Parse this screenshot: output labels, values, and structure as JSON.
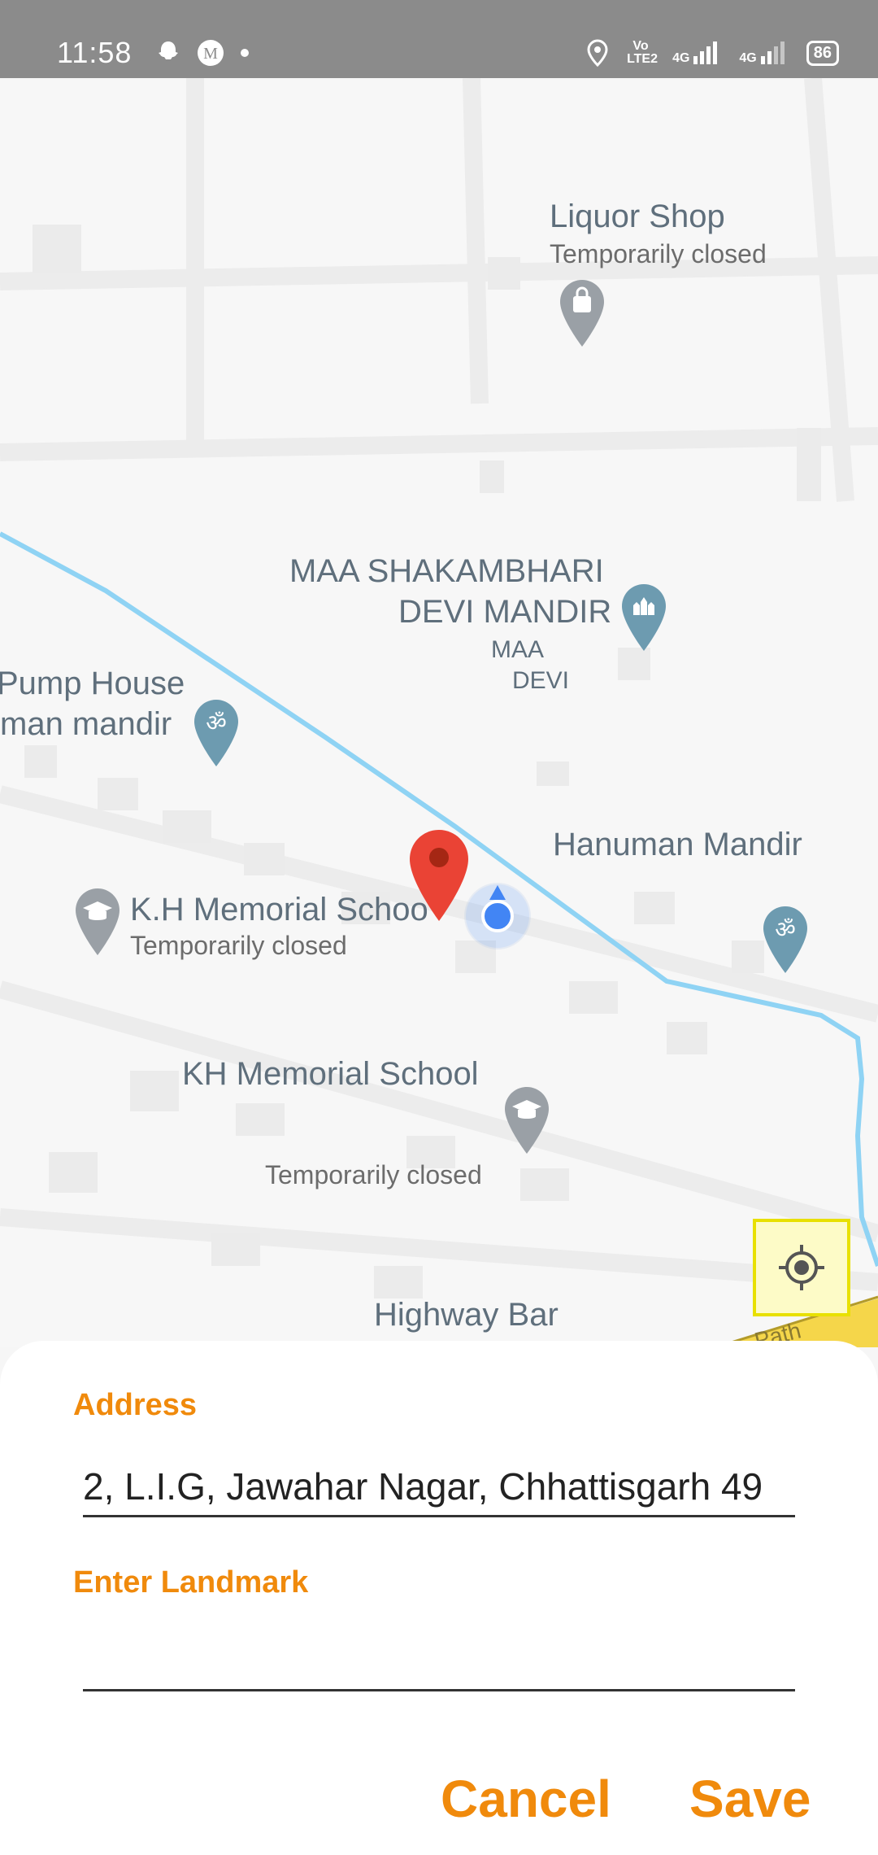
{
  "status_bar": {
    "time": "11:58",
    "volte_label": "Vo LTE2",
    "net1_label": "4G",
    "net2_label": "4G",
    "battery": "86"
  },
  "map": {
    "pois": {
      "liquor_shop": {
        "title": "Liquor Shop",
        "subtitle": "Temporarily closed"
      },
      "maa_mandir": {
        "title_line1": "MAA SHAKAMBHARI",
        "title_line2": "DEVI MANDIR",
        "sub_line1": "MAA",
        "sub_line2": "DEVI"
      },
      "pump_house": {
        "line1": "Pump House",
        "line2": "man mandir"
      },
      "hanuman_mandir": {
        "title": "Hanuman Mandir"
      },
      "kh_school_1": {
        "title": "K.H Memorial Schoo",
        "subtitle": "Temporarily closed"
      },
      "kh_school_2": {
        "title": "KH Memorial School",
        "subtitle": "Temporarily closed"
      },
      "highway_bar": {
        "title": "Highway Bar"
      },
      "road_label": "Path"
    }
  },
  "form": {
    "address_label": "Address",
    "address_value": "2, L.I.G, Jawahar Nagar, Chhattisgarh 49",
    "landmark_label": "Enter Landmark",
    "landmark_value": "",
    "cancel_label": "Cancel",
    "save_label": "Save"
  },
  "colors": {
    "accent": "#f08a0c",
    "statusbar": "#8b8b8b",
    "river": "#8fd3f4",
    "pin_red": "#ea4335",
    "location_blue": "#4285f4",
    "highlight": "#e8e000"
  },
  "icons": [
    "snapchat-icon",
    "gmail-icon",
    "location-status-icon",
    "signal-icon",
    "battery-icon",
    "shopping-bag-pin-icon",
    "temple-pin-icon",
    "om-pin-icon",
    "school-pin-icon",
    "red-map-pin-icon",
    "my-location-dot-icon",
    "gps-target-icon"
  ]
}
